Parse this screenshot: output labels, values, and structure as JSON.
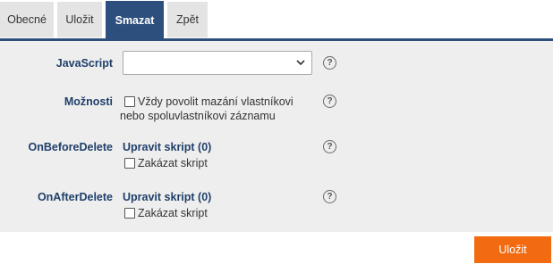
{
  "tabs": [
    {
      "label": "Obecné",
      "active": false
    },
    {
      "label": "Uložit",
      "active": false
    },
    {
      "label": "Smazat",
      "active": true
    },
    {
      "label": "Zpět",
      "active": false
    }
  ],
  "form": {
    "javascript": {
      "label": "JavaScript",
      "value": ""
    },
    "options": {
      "label": "Možnosti",
      "checkbox_line1": "Vždy povolit mazání vlastníkovi",
      "checkbox_line2": "nebo spoluvlastníkovi záznamu",
      "checked": false
    },
    "on_before_delete": {
      "label": "OnBeforeDelete",
      "link": "Upravit skript (0)",
      "disable_label": "Zakázat skript",
      "checked": false
    },
    "on_after_delete": {
      "label": "OnAfterDelete",
      "link": "Upravit skript (0)",
      "disable_label": "Zakázat skript",
      "checked": false
    },
    "help_symbol": "?"
  },
  "footer": {
    "save_label": "Uložit"
  },
  "colors": {
    "accent": "#2d4f7d",
    "save_button": "#f26b11",
    "panel": "#eeeeee",
    "label": "#1f3f6a"
  }
}
